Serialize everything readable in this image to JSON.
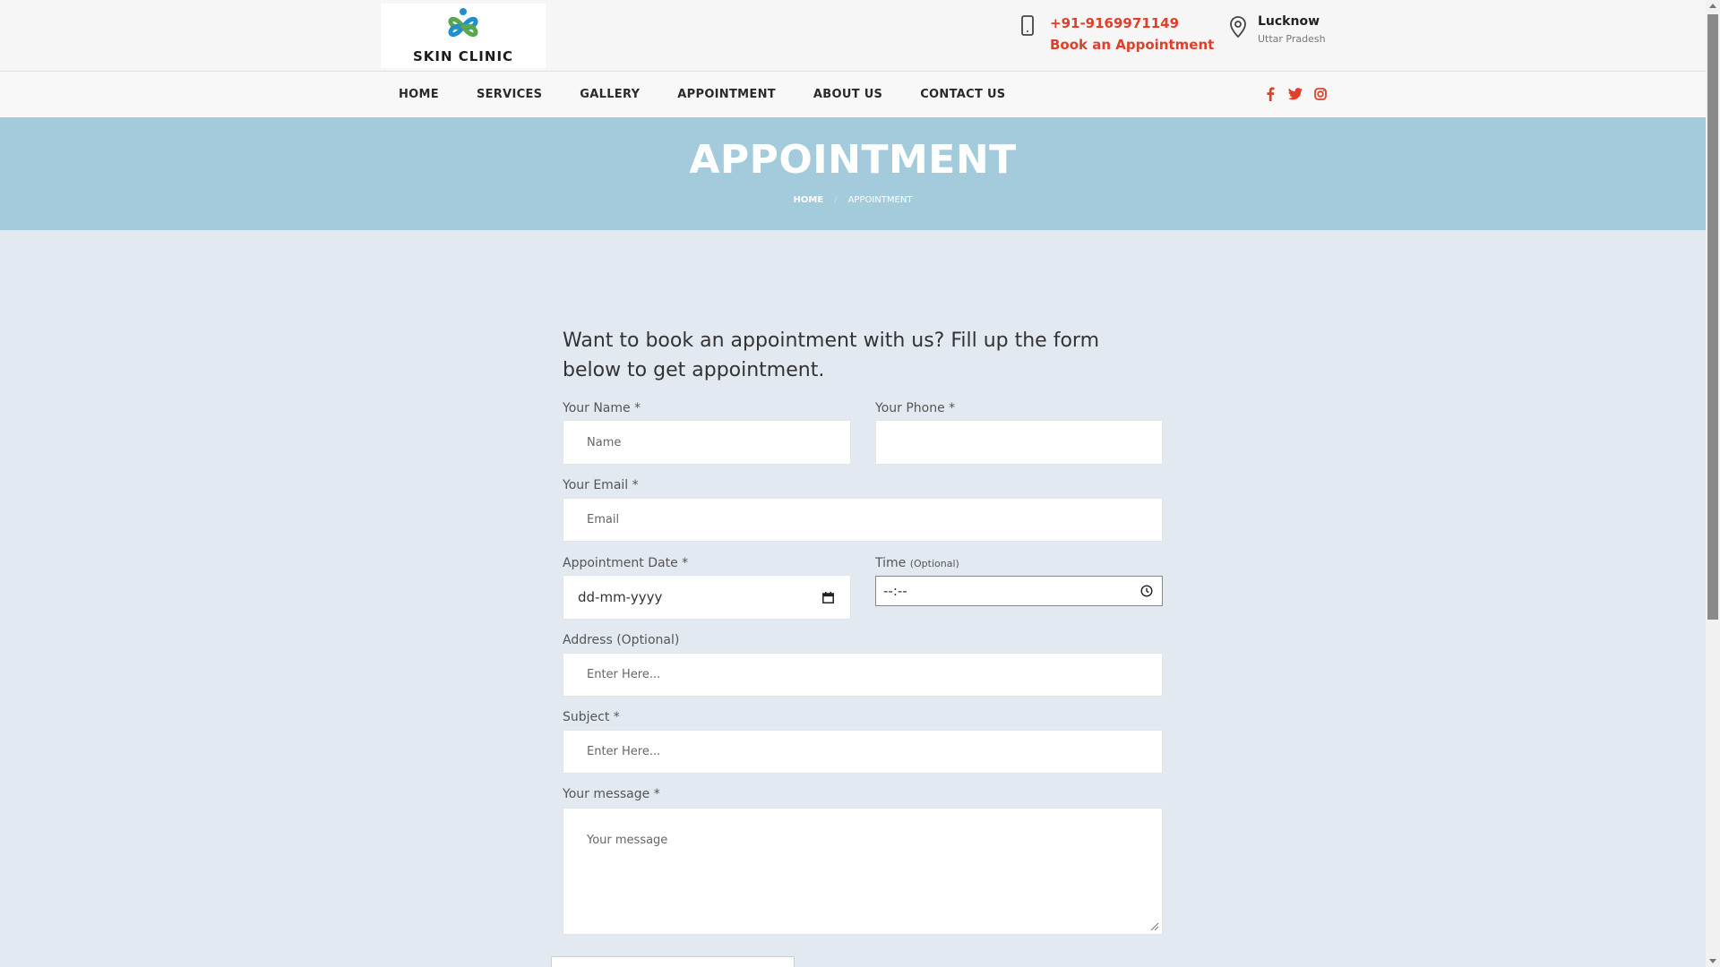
{
  "header": {
    "logo_text": "SKIN CLINIC",
    "phone": "+91-9169971149",
    "book_link": "Book an Appointment",
    "city": "Lucknow",
    "state": "Uttar Pradesh"
  },
  "nav": {
    "items": [
      "HOME",
      "SERVICES",
      "GALLERY",
      "APPOINTMENT",
      "ABOUT US",
      "CONTACT US"
    ],
    "socials": [
      "facebook-icon",
      "twitter-icon",
      "instagram-icon"
    ]
  },
  "banner": {
    "title": "APPOINTMENT",
    "crumb_home": "HOME",
    "crumb_sep": "/",
    "crumb_current": "APPOINTMENT"
  },
  "form": {
    "intro": "Want to book an appointment with us? Fill up the form below to get appointment.",
    "name_label": "Your Name *",
    "name_placeholder": "Name",
    "phone_label": "Your Phone *",
    "phone_placeholder": "",
    "email_label": "Your Email *",
    "email_placeholder": "Email",
    "date_label": "Appointment Date *",
    "date_placeholder": "dd-mm-yyyy",
    "time_label": "Time",
    "time_optional": "(Optional)",
    "time_placeholder": "--:--",
    "address_label": "Address (Optional)",
    "address_placeholder": "Enter Here...",
    "subject_label": "Subject *",
    "subject_placeholder": "Enter Here...",
    "message_label": "Your message *",
    "message_placeholder": "Your message"
  },
  "colors": {
    "accent": "#e0402a",
    "banner": "#a4cbdc",
    "page_bg": "#e3e9f1"
  }
}
